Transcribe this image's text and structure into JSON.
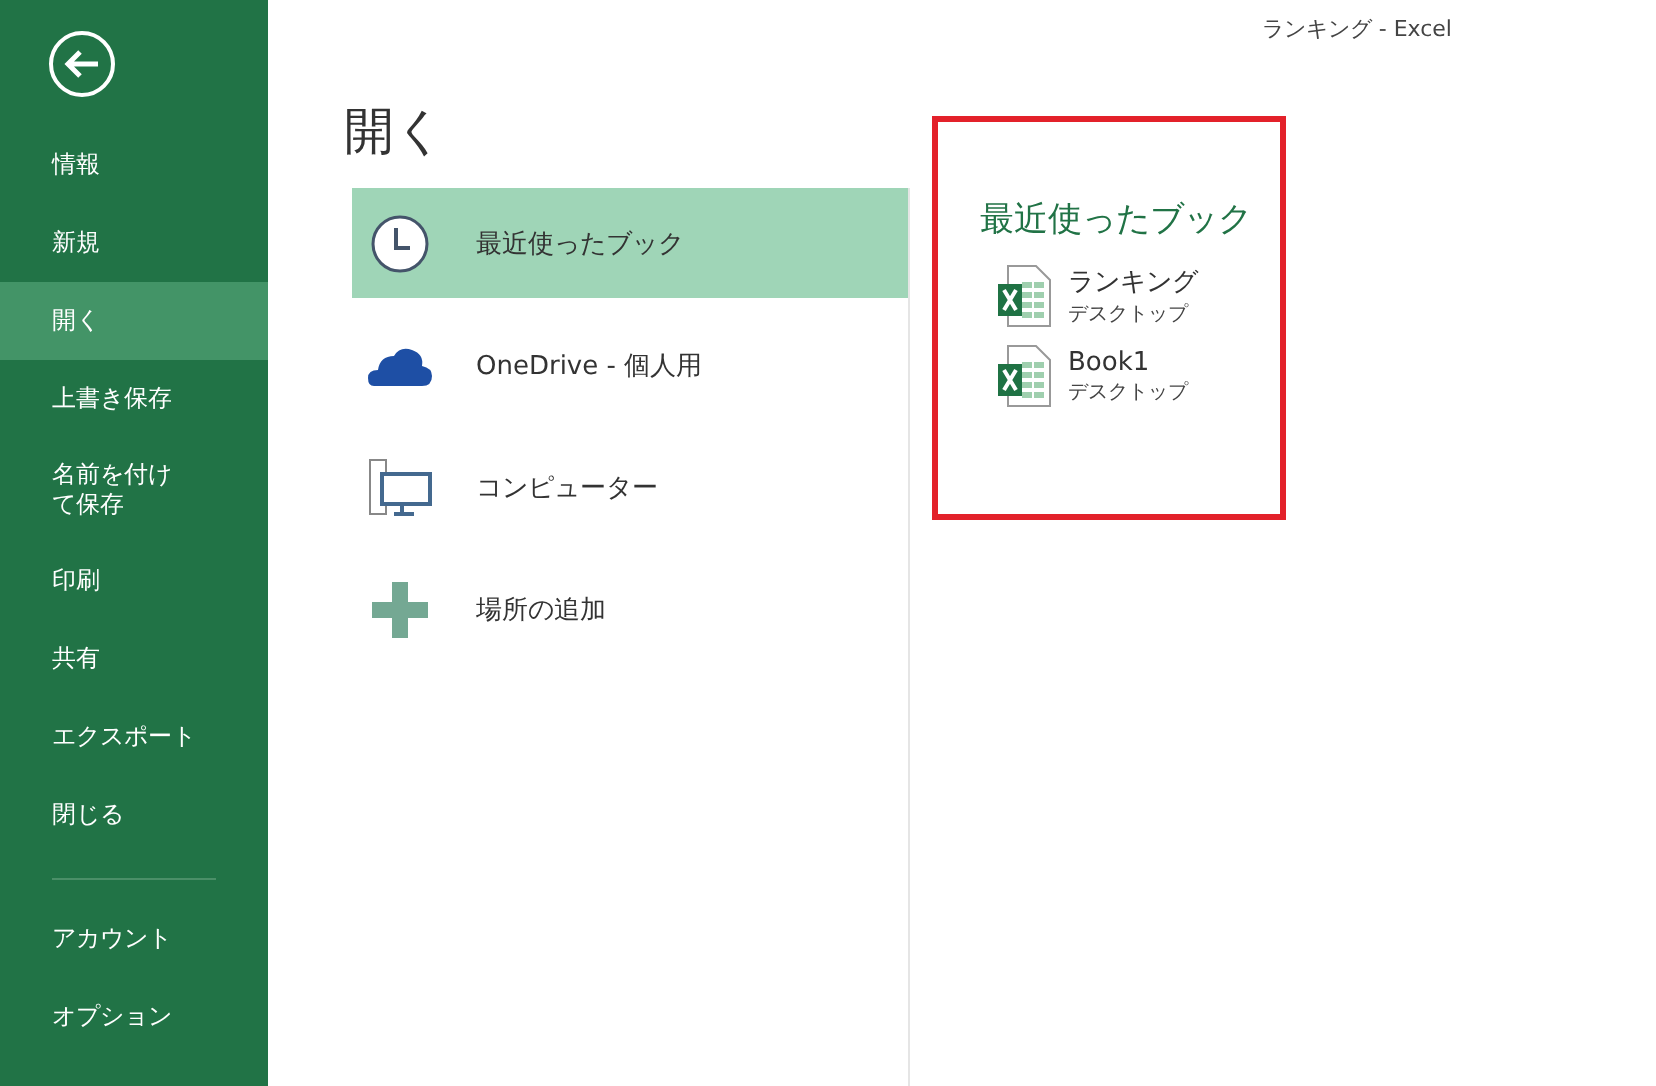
{
  "window": {
    "title": "ランキング - Excel"
  },
  "sidebar": {
    "items": [
      {
        "label": "情報",
        "selected": false
      },
      {
        "label": "新規",
        "selected": false
      },
      {
        "label": "開く",
        "selected": true
      },
      {
        "label": "上書き保存",
        "selected": false
      },
      {
        "label": "名前を付けて保存",
        "selected": false
      },
      {
        "label": "印刷",
        "selected": false
      },
      {
        "label": "共有",
        "selected": false
      },
      {
        "label": "エクスポート",
        "selected": false
      },
      {
        "label": "閉じる",
        "selected": false
      }
    ],
    "bottom_items": [
      {
        "label": "アカウント",
        "selected": false
      },
      {
        "label": "オプション",
        "selected": false
      }
    ]
  },
  "page_title": "開く",
  "places": [
    {
      "kind": "recent",
      "label": "最近使ったブック",
      "selected": true
    },
    {
      "kind": "onedrive",
      "label": "OneDrive - 個人用",
      "selected": false
    },
    {
      "kind": "computer",
      "label": "コンピューター",
      "selected": false
    },
    {
      "kind": "add",
      "label": "場所の追加",
      "selected": false
    }
  ],
  "recent": {
    "heading": "最近使ったブック",
    "files": [
      {
        "name": "ランキング",
        "location": "デスクトップ"
      },
      {
        "name": "Book1",
        "location": "デスクトップ"
      }
    ]
  }
}
